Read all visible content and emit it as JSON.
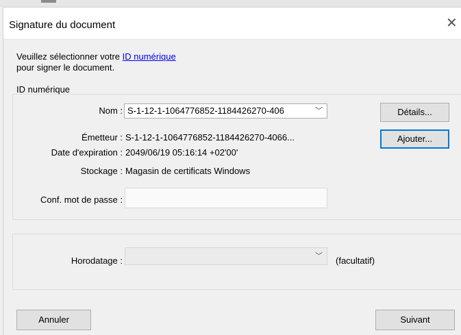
{
  "dialog": {
    "title": "Signature du document",
    "close_icon": "close-icon"
  },
  "intro": {
    "line1_prefix": "Veuillez sélectionner votre ",
    "link": "ID numérique",
    "line2": "pour signer le document."
  },
  "id_group": {
    "legend": "ID numérique",
    "nom_label": "Nom :",
    "nom_value": "S-1-12-1-1064776852-1184426270-406",
    "emetteur_label": "Émetteur :",
    "emetteur_value": "S-1-12-1-1064776852-1184426270-4066...",
    "expiration_label": "Date d'expiration :",
    "expiration_value": "2049/06/19 05:16:14 +02'00'",
    "stockage_label": "Stockage :",
    "stockage_value": "Magasin de certificats Windows",
    "password_label": "Conf. mot de passe :",
    "password_value": "",
    "details_button": "Détails...",
    "add_button": "Ajouter..."
  },
  "timestamp_group": {
    "label": "Horodatage :",
    "selected": "",
    "optional_note": "(facultatif)"
  },
  "footer": {
    "cancel_button": "Annuler",
    "next_button": "Suivant"
  },
  "colors": {
    "link": "#0000ee",
    "focus_border": "#0078d7",
    "button_bg": "#e1e1e1",
    "dialog_bg": "#f0f0f0"
  }
}
